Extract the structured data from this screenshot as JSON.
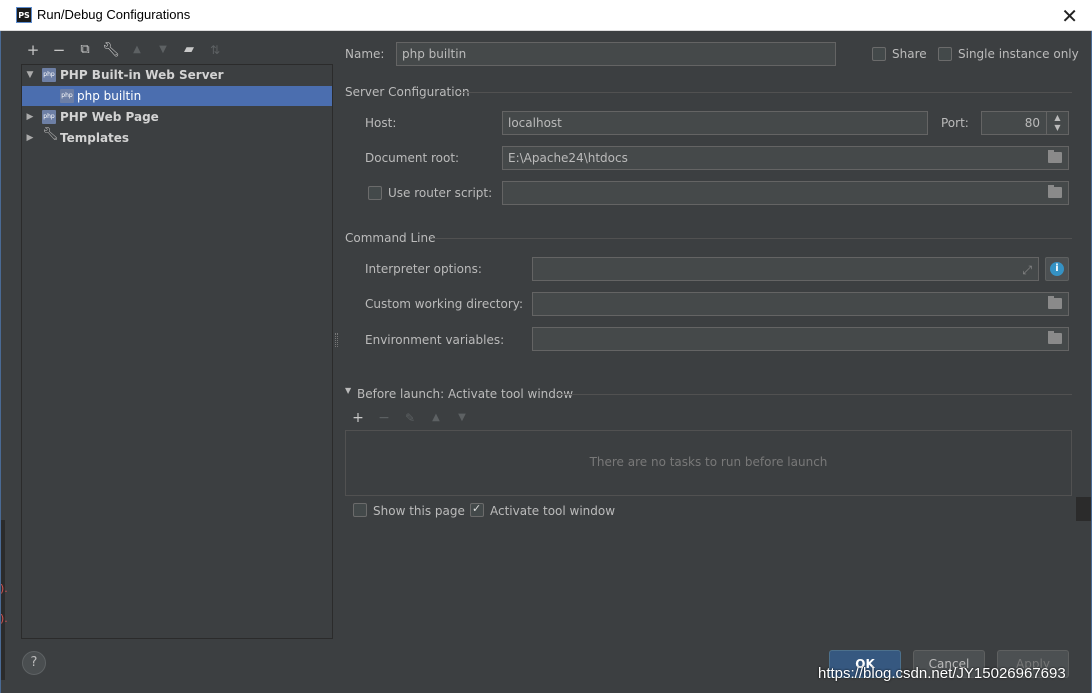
{
  "window": {
    "title": "Run/Debug Configurations",
    "logo": "PS",
    "close_glyph": "✕"
  },
  "tree_toolbar": {
    "icons": [
      "add-icon",
      "remove-icon",
      "copy-icon",
      "wrench-icon",
      "move-up-icon",
      "move-down-icon",
      "folder-icon",
      "sort-icon"
    ]
  },
  "tree": {
    "items": [
      {
        "label": "PHP Built-in Web Server",
        "expanded": true,
        "level": 0
      },
      {
        "label": "php builtin",
        "level": 1,
        "selected": true
      },
      {
        "label": "PHP Web Page",
        "expanded": false,
        "level": 0
      },
      {
        "label": "Templates",
        "expanded": false,
        "level": 0
      }
    ]
  },
  "header": {
    "name_label": "Name:",
    "name_value": "php builtin",
    "share_label": "Share",
    "single_instance_label": "Single instance only"
  },
  "server_config": {
    "title": "Server Configuration",
    "host_label": "Host:",
    "host_value": "localhost",
    "port_label": "Port:",
    "port_value": "80",
    "docroot_label": "Document root:",
    "docroot_value": "E:\\Apache24\\htdocs",
    "router_label": "Use router script:",
    "router_value": ""
  },
  "command_line": {
    "title": "Command Line",
    "interp_label": "Interpreter options:",
    "interp_value": "",
    "cwd_label": "Custom working directory:",
    "cwd_value": "",
    "env_label": "Environment variables:",
    "env_value": ""
  },
  "before_launch": {
    "title": "Before launch: Activate tool window",
    "empty_text": "There are no tasks to run before launch",
    "show_page_label": "Show this page",
    "show_page_checked": false,
    "activate_label": "Activate tool window",
    "activate_checked": true
  },
  "footer": {
    "help": "?",
    "ok": "OK",
    "cancel": "Cancel",
    "apply": "Apply"
  },
  "watermark": "https://blog.csdn.net/JY15026967693",
  "colors": {
    "background": "#3c3f41",
    "selection": "#4b6eaf",
    "primary_button": "#365880",
    "info": "#3592c4"
  }
}
